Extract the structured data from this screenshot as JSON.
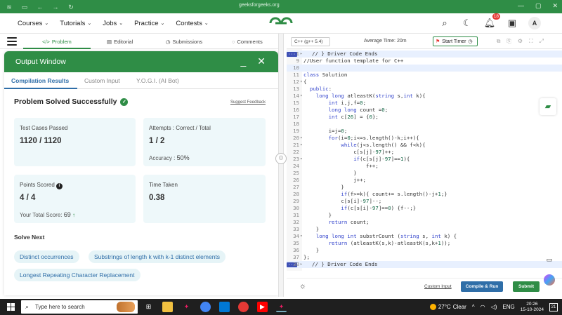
{
  "browser": {
    "url": "geeksforgeeks.org"
  },
  "header": {
    "nav": [
      {
        "label": "Courses"
      },
      {
        "label": "Tutorials"
      },
      {
        "label": "Jobs"
      },
      {
        "label": "Practice"
      },
      {
        "label": "Contests"
      }
    ],
    "notification_count": "18",
    "avatar_letter": "A"
  },
  "tabs": {
    "problem": "Problem",
    "editorial": "Editorial",
    "submissions": "Submissions",
    "comments": "Comments"
  },
  "output": {
    "title": "Output Window",
    "tabs": [
      "Compilation Results",
      "Custom Input",
      "Y.O.G.I. (AI Bot)"
    ],
    "status": "Problem Solved Successfully",
    "suggest_feedback": "Suggest Feedback",
    "test_cases_label": "Test Cases Passed",
    "test_cases_value": "1120 / 1120",
    "attempts_label": "Attempts : Correct / Total",
    "attempts_value": "1 / 2",
    "accuracy_label": "Accuracy :",
    "accuracy_value": "50%",
    "points_label": "Points Scored",
    "points_value": "4 / 4",
    "total_score_label": "Your Total Score:",
    "total_score_value": "69",
    "time_label": "Time Taken",
    "time_value": "0.38",
    "solve_next_label": "Solve Next",
    "solve_next": [
      "Distinct occurrences",
      "Substrings of length k with k-1 distinct elements",
      "Longest Repeating Character Replacement"
    ]
  },
  "editor": {
    "language": "C++ (g++ 5.4)",
    "avg_time": "Average Time: 20m",
    "start_timer": "Start Timer",
    "custom_input": "Custom Input",
    "compile_run": "Compile & Run",
    "submit": "Submit",
    "lines": [
      {
        "n": "1",
        "fold": "▸",
        "text": "// } Driver Code Ends",
        "hl": true,
        "marker": true
      },
      {
        "n": "9",
        "fold": "",
        "text": "//User function template for C++",
        "hl": false
      },
      {
        "n": "10",
        "fold": "",
        "text": "",
        "hl": true
      },
      {
        "n": "11",
        "fold": "",
        "text": "class Solution",
        "hl": false
      },
      {
        "n": "12",
        "fold": "▾",
        "text": "{",
        "hl": false
      },
      {
        "n": "13",
        "fold": "",
        "text": "  public:",
        "hl": false
      },
      {
        "n": "14",
        "fold": "▾",
        "text": "    long long atleastK(string s,int k){",
        "hl": false
      },
      {
        "n": "15",
        "fold": "",
        "text": "        int i,j,f=0;",
        "hl": false
      },
      {
        "n": "16",
        "fold": "",
        "text": "        long long count =0;",
        "hl": false
      },
      {
        "n": "17",
        "fold": "",
        "text": "        int c[26] = {0};",
        "hl": false
      },
      {
        "n": "18",
        "fold": "",
        "text": "",
        "hl": false
      },
      {
        "n": "19",
        "fold": "",
        "text": "        i=j=0;",
        "hl": false
      },
      {
        "n": "20",
        "fold": "▾",
        "text": "        for(i=0;i<=s.length()-k;i++){",
        "hl": false
      },
      {
        "n": "21",
        "fold": "▾",
        "text": "            while(j<s.length() && f<k){",
        "hl": false
      },
      {
        "n": "22",
        "fold": "",
        "text": "                c[s[j]-97]++;",
        "hl": false
      },
      {
        "n": "23",
        "fold": "▾",
        "text": "                if(c[s[j]-97]==1){",
        "hl": false
      },
      {
        "n": "24",
        "fold": "",
        "text": "                    f++;",
        "hl": false
      },
      {
        "n": "25",
        "fold": "",
        "text": "                }",
        "hl": false
      },
      {
        "n": "26",
        "fold": "",
        "text": "                j++;",
        "hl": false
      },
      {
        "n": "27",
        "fold": "",
        "text": "            }",
        "hl": false
      },
      {
        "n": "28",
        "fold": "",
        "text": "            if(f>=k){ count+= s.length()-j+1;}",
        "hl": false
      },
      {
        "n": "29",
        "fold": "",
        "text": "            c[s[i]-97]--;",
        "hl": false
      },
      {
        "n": "30",
        "fold": "",
        "text": "            if(c[s[i]-97]==0) {f--;}",
        "hl": false
      },
      {
        "n": "31",
        "fold": "",
        "text": "        }",
        "hl": false
      },
      {
        "n": "32",
        "fold": "",
        "text": "        return count;",
        "hl": false
      },
      {
        "n": "33",
        "fold": "",
        "text": "    }",
        "hl": false
      },
      {
        "n": "34",
        "fold": "▾",
        "text": "    long long int substrCount (string s, int k) {",
        "hl": false
      },
      {
        "n": "35",
        "fold": "",
        "text": "        return (atleastK(s,k)-atleastK(s,k+1));",
        "hl": false
      },
      {
        "n": "36",
        "fold": "",
        "text": "    }",
        "hl": false
      },
      {
        "n": "37",
        "fold": "",
        "text": "};",
        "hl": false
      },
      {
        "n": "38",
        "fold": "▸",
        "text": "// } Driver Code Ends",
        "hl": true,
        "marker": true
      }
    ]
  },
  "taskbar": {
    "search_placeholder": "Type here to search",
    "temperature": "27°C",
    "weather": "Clear",
    "language": "ENG",
    "time": "20:26",
    "date": "15-10-2024",
    "notifications": "21"
  },
  "colors": {
    "brand": "#2f8d46",
    "link": "#2f6ea8"
  }
}
